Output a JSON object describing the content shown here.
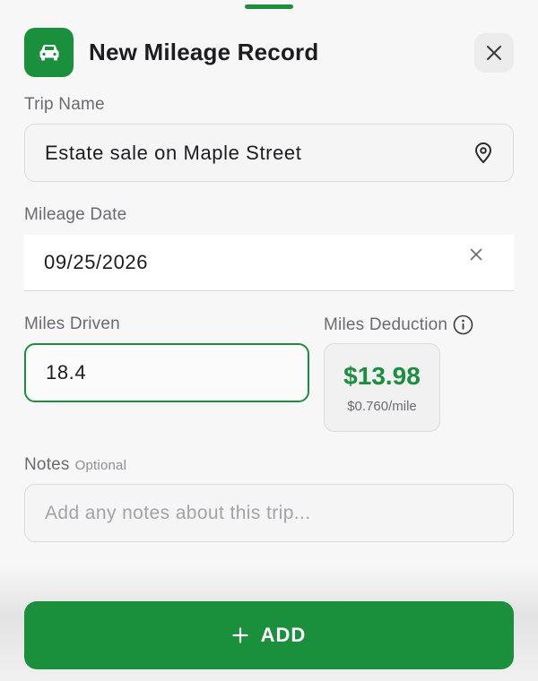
{
  "header": {
    "title": "New Mileage Record",
    "icon": "car-icon",
    "close_icon": "close-icon"
  },
  "trip_name": {
    "label": "Trip Name",
    "value": "Estate sale on Maple Street",
    "icon": "location-pin-icon"
  },
  "mileage_date": {
    "label": "Mileage Date",
    "value": "09/25/2026",
    "clear_icon": "clear-icon"
  },
  "miles_driven": {
    "label": "Miles Driven",
    "value": "18.4"
  },
  "miles_deduction": {
    "label": "Miles Deduction",
    "info_icon": "info-icon",
    "amount": "$13.98",
    "rate": "$0.760/mile"
  },
  "notes": {
    "label": "Notes",
    "optional": "Optional",
    "placeholder": "Add any notes about this trip..."
  },
  "add_button": {
    "label": "ADD",
    "icon": "plus-icon"
  },
  "colors": {
    "accent": "#1a8f3c",
    "background": "#f7f7f7"
  }
}
